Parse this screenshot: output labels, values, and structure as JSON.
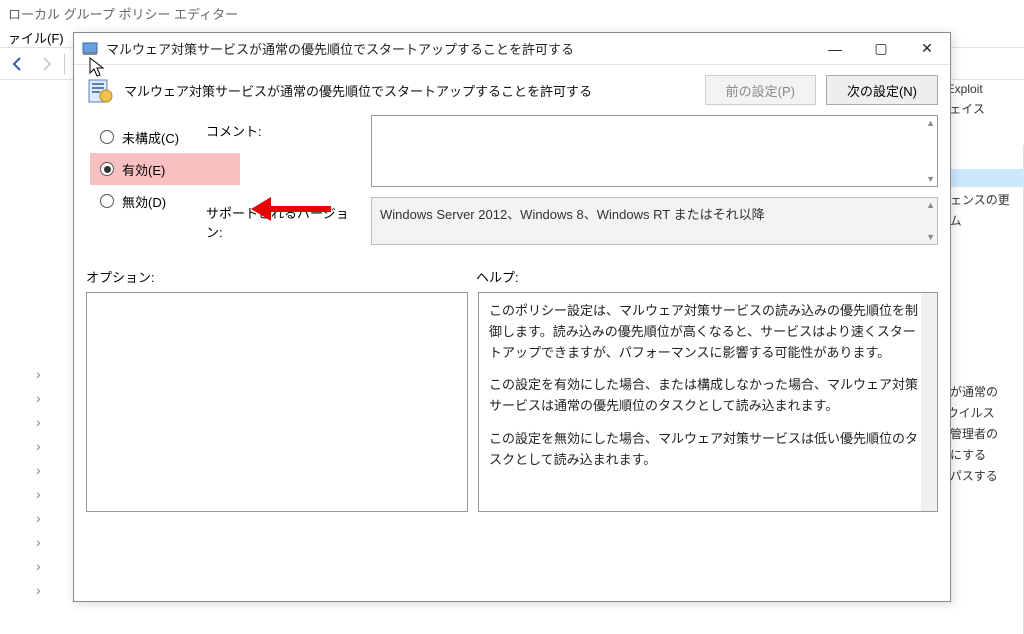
{
  "parent": {
    "title": "ローカル グループ ポリシー エディター",
    "menu_file": "ァイル(F)"
  },
  "side_right": [
    "der Exploit",
    "ーフェイス",
    "",
    "リジェンスの更",
    "ステム",
    "",
    "ビスが通常の",
    "der ウイルス",
    "カル管理者の",
    "無効にする",
    "バイパスする"
  ],
  "dialog": {
    "title": "マルウェア対策サービスが通常の優先順位でスタートアップすることを許可する",
    "header_text": "マルウェア対策サービスが通常の優先順位でスタートアップすることを許可する",
    "prev_btn": "前の設定(P)",
    "next_btn": "次の設定(N)",
    "radio": {
      "not_configured": "未構成(C)",
      "enabled": "有効(E)",
      "disabled": "無効(D)"
    },
    "comment_label": "コメント:",
    "comment_value": "",
    "supported_label": "サポートされるバージョン:",
    "supported_value": "Windows Server 2012、Windows 8、Windows RT またはそれ以降",
    "options_label": "オプション:",
    "help_label": "ヘルプ:",
    "help_body": {
      "p1": "このポリシー設定は、マルウェア対策サービスの読み込みの優先順位を制御します。読み込みの優先順位が高くなると、サービスはより速くスタートアップできますが、パフォーマンスに影響する可能性があります。",
      "p2": "この設定を有効にした場合、または構成しなかった場合、マルウェア対策サービスは通常の優先順位のタスクとして読み込まれます。",
      "p3": "この設定を無効にした場合、マルウェア対策サービスは低い優先順位のタスクとして読み込まれます。"
    }
  }
}
